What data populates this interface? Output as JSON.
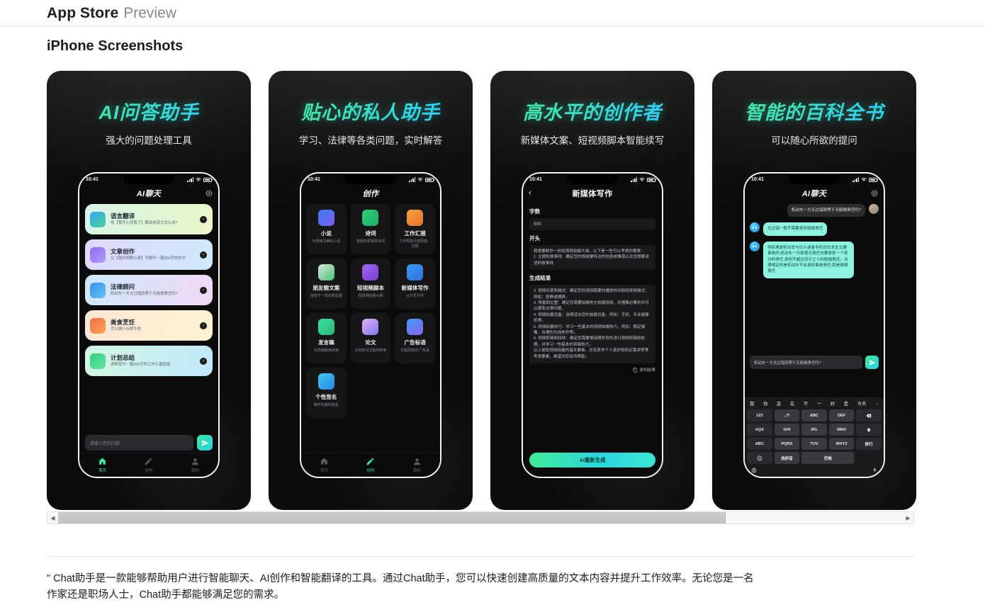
{
  "header": {
    "brand": "App Store",
    "preview": "Preview",
    "section_title": "iPhone Screenshots"
  },
  "colors": {
    "accent_green": "#3de89a",
    "accent_cyan": "#2ad6f5",
    "panel_bg": "#0c0c0c",
    "bubble_bot": "#8ef3e0"
  },
  "status_bar": {
    "time": "10:41"
  },
  "screenshots": [
    {
      "title": "AI问答助手",
      "subtitle": "强大的问题处理工具",
      "phone_title": "AI聊天",
      "cards": [
        {
          "name": "语言翻译",
          "desc": "将【我开心死我了】翻译成英文怎么说?",
          "c1": "#d7f5e6",
          "c2": "#eaf7c8",
          "ic1": "#3ba7f0",
          "ic2": "#45d19a"
        },
        {
          "name": "文章创作",
          "desc": "以【我的明朗心事】为题写一篇500字的作文",
          "c1": "#ded9fb",
          "c2": "#cfe9fb",
          "ic1": "#8b6cf0",
          "ic2": "#b59bff"
        },
        {
          "name": "法律顾问",
          "desc": "机动车一方无过错就等于无赔偿责任吗?",
          "c1": "#cfe8fb",
          "c2": "#f0d8f6",
          "ic1": "#3d8ff0",
          "ic2": "#5fc6f5"
        },
        {
          "name": "美食烹饪",
          "desc": "怎么做小炒黄牛肉",
          "c1": "#fde7d6",
          "c2": "#fdf3cf",
          "ic1": "#f76a4a",
          "ic2": "#fba84f"
        },
        {
          "name": "计划总结",
          "desc": "请帮我写一篇500字的工作汇报提纲",
          "c1": "#d4f7e3",
          "c2": "#bfe8fb",
          "ic1": "#2fcf7d",
          "ic2": "#6fe3a8"
        }
      ],
      "composer_placeholder": "请输入您的问题…",
      "tabs": [
        {
          "label": "首页",
          "icon": "home-icon",
          "active": true
        },
        {
          "label": "创作",
          "icon": "pen-icon",
          "active": false
        },
        {
          "label": "我的",
          "icon": "user-icon",
          "active": false
        }
      ]
    },
    {
      "title": "贴心的私人助手",
      "subtitle": "学习、法律等各类问题，实时解答",
      "phone_title": "创作",
      "tools": [
        {
          "name": "小说",
          "desc": "为您续写精彩小说",
          "c1": "#3a7bf0",
          "c2": "#7f5bf5"
        },
        {
          "name": "诗词",
          "desc": "智能构思随意诗词",
          "c1": "#2fd07a",
          "c2": "#1fae63"
        },
        {
          "name": "工作汇报",
          "desc": "工作周复月报周报、日报",
          "c1": "#f7a13d",
          "c2": "#e8732b"
        },
        {
          "name": "朋友圈文案",
          "desc": "体验不一样的朋友圈",
          "c1": "#d8e7d2",
          "c2": "#49c07a"
        },
        {
          "name": "短视频脚本",
          "desc": "短视频拍摄大纲",
          "c1": "#a265f0",
          "c2": "#7a3fd4"
        },
        {
          "name": "新媒体写作",
          "desc": "公众号写作",
          "c1": "#3d9cf5",
          "c2": "#2c6fe0"
        },
        {
          "name": "发言稿",
          "desc": "为您编辑演讲稿",
          "c1": "#3de0a1",
          "c2": "#2ab977"
        },
        {
          "name": "论文",
          "desc": "为您的论文提供参考",
          "c1": "#e2b0f0",
          "c2": "#7f78f0"
        },
        {
          "name": "广告标语",
          "desc": "挖掘同款的广告语",
          "c1": "#3d9cf5",
          "c2": "#8a63f0"
        },
        {
          "name": "个性签名",
          "desc": "制作有趣的签名",
          "c1": "#3ec9f5",
          "c2": "#2a86e0"
        }
      ],
      "tabs": [
        {
          "label": "首页",
          "icon": "home-icon",
          "active": false
        },
        {
          "label": "创作",
          "icon": "pen-icon",
          "active": true
        },
        {
          "label": "我的",
          "icon": "user-icon",
          "active": false
        }
      ]
    },
    {
      "title": "高水平的创作者",
      "subtitle": "新媒体文案、短视频脚本智能续写",
      "phone_title": "新媒体写作",
      "form": {
        "count_label": "字数",
        "count_value": "500",
        "start_label": "开头",
        "start_text": "我想要制作一份短视频拍摄大纲，以下是一些可以考虑的要素：\n1. 主题和故事线：确定您的视频要传达的信息或情感以及您想要讲述的故事线",
        "result_label": "生成结果",
        "result_text": "2. 视频长度和格式：确定您的视频需要的播放时间和短视频格式，例如：竖屏或横屏。\n3. 场景和位置：确定您需要拍摄地方拍摄现场，并搜集必要的许可以避免法律问题。\n4. 视频拍摄设备：选择适合您的拍摄设备，例如：手机、专业摄像机等。\n5. 视频拍摄技巧：学习一些基本的视频拍摄技巧，例如：稳定摄像、合理的光线条件等。\n6. 视频剪辑和特效：确定您需要使用哪些软件进行视频剪辑和处理，并学习一些基本的剪辑技巧。\n以上是短视频拍摄的基本要素，还有更多个人喜好和特定需求等等考虑要素。希望对您有所帮助。",
        "copy_label": "复制结果",
        "regen_label": "AI重新生成"
      }
    },
    {
      "title": "智能的百科全书",
      "subtitle": "可以随心所欲的提问",
      "phone_title": "AI聊天",
      "messages": [
        {
          "from": "user",
          "text": "机动车一方无过错就等于无赔偿责任吗?"
        },
        {
          "from": "bot",
          "text": "无过错一般不需要承担赔偿责任"
        },
        {
          "from": "bot",
          "text": "但如果是机动车与行人或者非机动车发生交通事故的,机动车一方即使无责任也要承担一个部分的责任,承担不超过百分之十的赔偿责任。法律规定的是机动车不会承担事故责任,而是赔偿责任"
        }
      ],
      "input_value": "机动车一方无过错就等于无赔偿责任吗?",
      "keyboard": {
        "suggestions": [
          "我",
          "你",
          "这",
          "在",
          "不",
          "一",
          "好",
          "是",
          "今天"
        ],
        "keys": [
          "123",
          ".,?!",
          "ABC",
          "DEF",
          "delete-icon",
          "#@¥",
          "GHI",
          "JKL",
          "MNO",
          "shift-icon",
          "ABC",
          "PQRS",
          "TUV",
          "WXYZ",
          "换行",
          "emoji-icon",
          "选拼音",
          "空格"
        ]
      }
    }
  ],
  "scrollbar": {
    "left_arrow": "◀",
    "right_arrow": "▶",
    "thumb_percent": 79
  },
  "footer": {
    "text": "\" Chat助手是一款能够帮助用户进行智能聊天、AI创作和智能翻译的工具。通过Chat助手，您可以快速创建高质量的文本内容并提升工作效率。无论您是一名作家还是职场人士，Chat助手都能够满足您的需求。"
  }
}
